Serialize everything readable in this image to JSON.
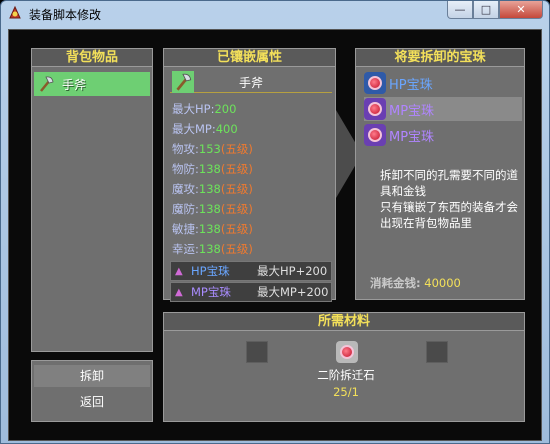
{
  "window": {
    "title": "装备脚本修改",
    "controls": [
      "—",
      "□",
      "✕"
    ]
  },
  "bag": {
    "header": "背包物品",
    "items": [
      {
        "label": "手斧",
        "icon": "axe-icon"
      }
    ],
    "actions": {
      "unmount": "拆卸",
      "back": "返回"
    }
  },
  "inlaid": {
    "header": "已镶嵌属性",
    "item": {
      "label": "手斧",
      "icon": "axe-icon"
    },
    "stats": [
      {
        "key": "最大HP:",
        "value": "200",
        "level": ""
      },
      {
        "key": "最大MP:",
        "value": "400",
        "level": ""
      },
      {
        "key": "物攻:",
        "value": "153",
        "level": "(五级)"
      },
      {
        "key": "物防:",
        "value": "138",
        "level": "(五级)"
      },
      {
        "key": "魔攻:",
        "value": "138",
        "level": "(五级)"
      },
      {
        "key": "魔防:",
        "value": "138",
        "level": "(五级)"
      },
      {
        "key": "敏捷:",
        "value": "138",
        "level": "(五级)"
      },
      {
        "key": "幸运:",
        "value": "138",
        "level": "(五级)"
      }
    ],
    "gems": [
      {
        "name": "HP宝珠",
        "effect": "最大HP+200",
        "type": "hp"
      },
      {
        "name": "MP宝珠",
        "effect": "最大MP+200",
        "type": "mp"
      }
    ]
  },
  "gems_panel": {
    "header": "将要拆卸的宝珠",
    "items": [
      {
        "name": "HP宝珠",
        "type": "hp",
        "highlighted": false
      },
      {
        "name": "MP宝珠",
        "type": "mp",
        "highlighted": true
      },
      {
        "name": "MP宝珠",
        "type": "mp",
        "highlighted": false
      }
    ],
    "notice_line1": "拆卸不同的孔需要不同的道具和金钱",
    "notice_line2": "只有镶嵌了东西的装备才会出现在背包物品里",
    "cost_label": "消耗金钱:",
    "cost_value": "40000"
  },
  "materials": {
    "header": "所需材料",
    "item_name": "二阶拆迁石",
    "item_count": "25/1"
  },
  "colors": {
    "accent_yellow": "#f3e05a",
    "bag_highlight": "#6ecf73",
    "stat_value": "#6de35b",
    "stat_level": "#f07a2f"
  }
}
